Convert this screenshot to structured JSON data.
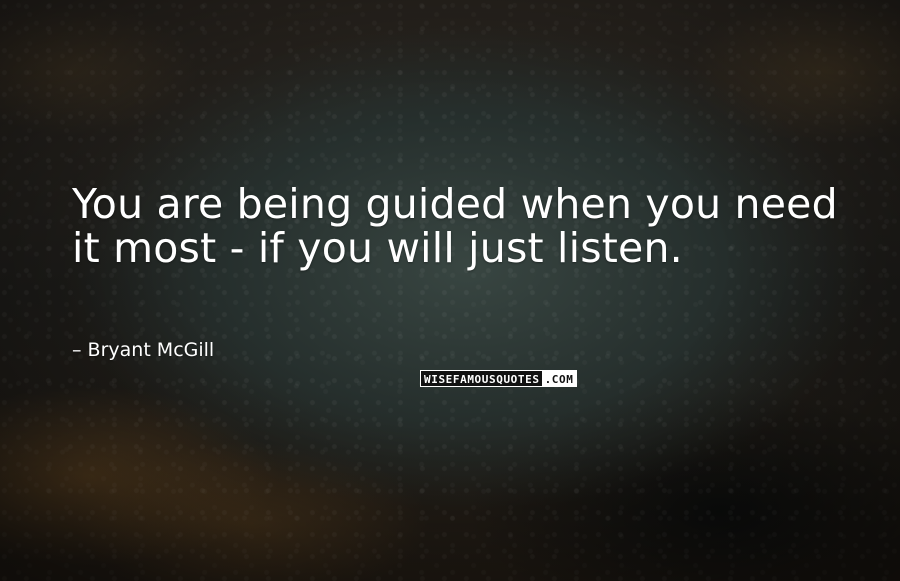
{
  "quote": {
    "text": "You are being guided when you need it most  -  if you will just listen."
  },
  "author": {
    "text": "Bryant McGill"
  },
  "watermark": {
    "part1": "WISEFAMOUSQUOTES",
    "part2": ".COM"
  },
  "colors": {
    "text": "#ffffff",
    "background_dark": "#1d1c19",
    "accent_warm": "#7a5224"
  }
}
